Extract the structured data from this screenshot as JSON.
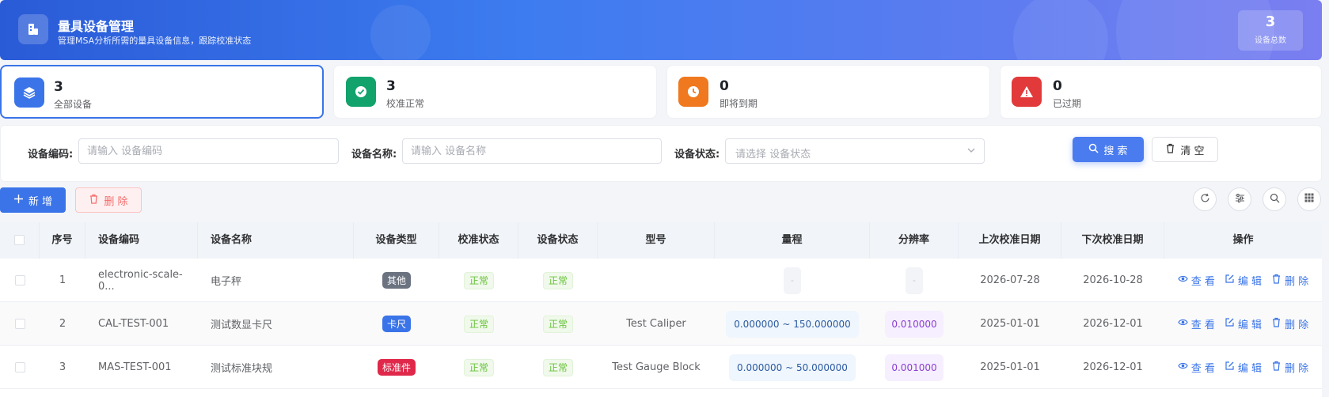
{
  "header": {
    "title": "量具设备管理",
    "subtitle": "管理MSA分析所需的量具设备信息，跟踪校准状态",
    "total_count": "3",
    "total_label": "设备总数"
  },
  "stats": [
    {
      "count": "3",
      "label": "全部设备",
      "color": "#3a74e8",
      "icon": "layers-icon"
    },
    {
      "count": "3",
      "label": "校准正常",
      "color": "#12a26c",
      "icon": "check-circle-icon"
    },
    {
      "count": "0",
      "label": "即将到期",
      "color": "#f0781e",
      "icon": "clock-icon"
    },
    {
      "count": "0",
      "label": "已过期",
      "color": "#e23a3a",
      "icon": "warning-icon"
    }
  ],
  "search": {
    "code_label": "设备编码:",
    "code_placeholder": "请输入 设备编码",
    "name_label": "设备名称:",
    "name_placeholder": "请输入 设备名称",
    "status_label": "设备状态:",
    "status_placeholder": "请选择 设备状态",
    "search_btn": "搜 索",
    "clear_btn": "清 空"
  },
  "toolbar": {
    "add_btn": "新 增",
    "delete_btn": "删 除"
  },
  "table": {
    "headers": [
      "序号",
      "设备编码",
      "设备名称",
      "设备类型",
      "校准状态",
      "设备状态",
      "型号",
      "量程",
      "分辨率",
      "上次校准日期",
      "下次校准日期",
      "操作"
    ],
    "rows": [
      {
        "idx": "1",
        "code": "electronic-scale-0...",
        "name": "电子秤",
        "type": "其他",
        "type_color": "#6b7280",
        "calib": "正常",
        "status": "正常",
        "model": "",
        "range_min": "",
        "range_sep": "",
        "range_max": "",
        "range_empty": "-",
        "resolution": "",
        "res_empty": "-",
        "last": "2026-07-28",
        "next": "2026-10-28"
      },
      {
        "idx": "2",
        "code": "CAL-TEST-001",
        "name": "测试数显卡尺",
        "type": "卡尺",
        "type_color": "#3a74e8",
        "calib": "正常",
        "status": "正常",
        "model": "Test Caliper",
        "range_min": "0.000000",
        "range_sep": "~",
        "range_max": "150.000000",
        "range_empty": "",
        "resolution": "0.010000",
        "res_empty": "",
        "last": "2025-01-01",
        "next": "2026-12-01"
      },
      {
        "idx": "3",
        "code": "MAS-TEST-001",
        "name": "测试标准块规",
        "type": "标准件",
        "type_color": "#e0284a",
        "calib": "正常",
        "status": "正常",
        "model": "Test Gauge Block",
        "range_min": "0.000000",
        "range_sep": "~",
        "range_max": "50.000000",
        "range_empty": "",
        "resolution": "0.001000",
        "res_empty": "",
        "last": "2025-01-01",
        "next": "2026-12-01"
      }
    ],
    "actions": {
      "view": "查 看",
      "edit": "编 辑",
      "delete": "删 除"
    }
  }
}
